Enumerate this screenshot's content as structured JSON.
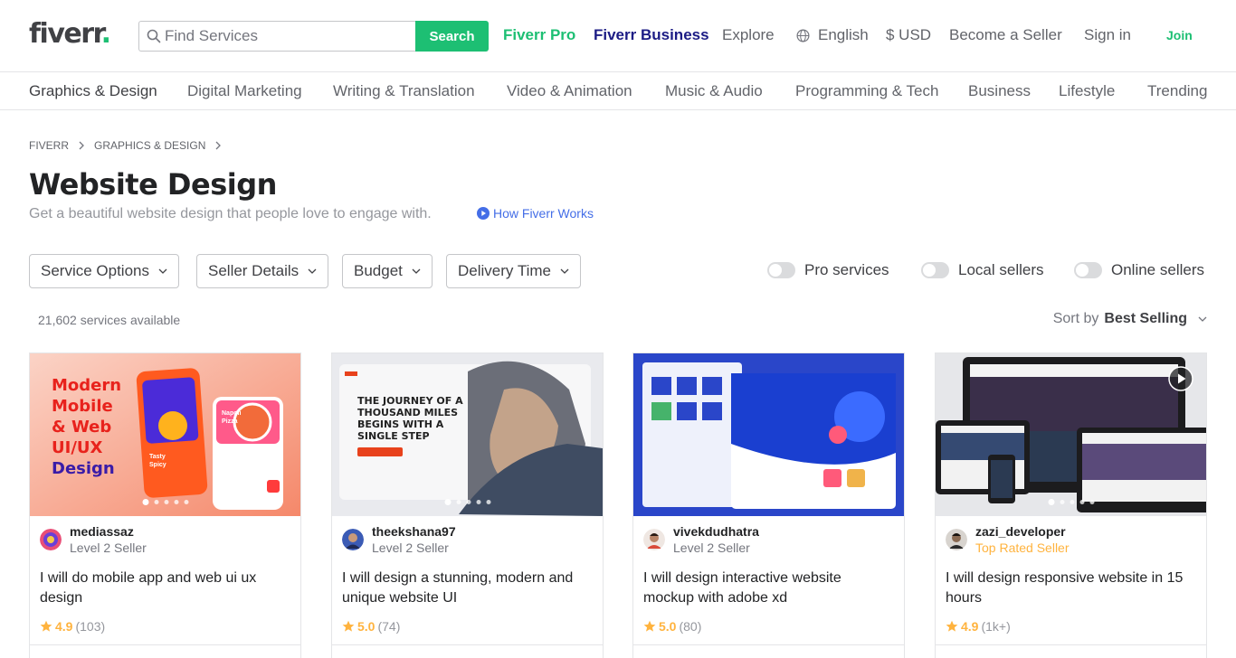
{
  "header": {
    "logo": "fiverr",
    "logo_dot": ".",
    "search_placeholder": "Find Services",
    "search_button": "Search",
    "nav": {
      "pro": "Fiverr Pro",
      "business": "Fiverr Business",
      "explore": "Explore",
      "language": "English",
      "currency": "$ USD",
      "become_seller": "Become a Seller",
      "sign_in": "Sign in",
      "join": "Join"
    }
  },
  "categories": [
    "Graphics & Design",
    "Digital Marketing",
    "Writing & Translation",
    "Video & Animation",
    "Music & Audio",
    "Programming & Tech",
    "Business",
    "Lifestyle",
    "Trending"
  ],
  "breadcrumb": [
    "FIVERR",
    "GRAPHICS & DESIGN"
  ],
  "page": {
    "title": "Website Design",
    "subtitle": "Get a beautiful website design that people love to engage with.",
    "how_works": "How Fiverr Works"
  },
  "filters": [
    "Service Options",
    "Seller Details",
    "Budget",
    "Delivery Time"
  ],
  "toggles": [
    "Pro services",
    "Local sellers",
    "Online sellers"
  ],
  "results": {
    "count": "21,602 services available",
    "sort_label": "Sort by",
    "sort_value": "Best Selling"
  },
  "thumb_text": {
    "card1": [
      "Modern",
      "Mobile",
      "& Web",
      "UI/UX",
      "Design"
    ],
    "card1_phone": [
      "Napoli",
      "Pizza",
      "Tasty",
      "Spicy"
    ],
    "card2": [
      "THE JOURNEY OF A",
      "THOUSAND MILES",
      "BEGINS WITH A",
      "SINGLE STEP"
    ]
  },
  "cards": [
    {
      "seller": "mediassaz",
      "level": "Level 2 Seller",
      "title": "I will do mobile app and web ui ux design",
      "rating": "4.9",
      "count": "(103)"
    },
    {
      "seller": "theekshana97",
      "level": "Level 2 Seller",
      "title": "I will design a stunning, modern and unique website UI",
      "rating": "5.0",
      "count": "(74)"
    },
    {
      "seller": "vivekdudhatra",
      "level": "Level 2 Seller",
      "title": "I will design interactive website mockup with adobe xd",
      "rating": "5.0",
      "count": "(80)"
    },
    {
      "seller": "zazi_developer",
      "level": "Top Rated Seller",
      "title": "I will design responsive website in 15 hours",
      "rating": "4.9",
      "count": "(1k+)"
    }
  ],
  "colors": {
    "brand": "#1dbf73",
    "business": "#1c1c85",
    "star": "#ffb33e",
    "link": "#446ee7"
  }
}
